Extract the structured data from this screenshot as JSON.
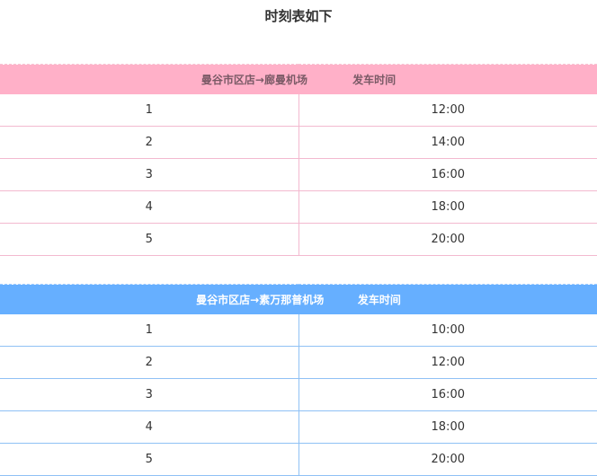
{
  "title": "时刻表如下",
  "tables": [
    {
      "header": "曼谷市区店→廊曼机场            发车时间",
      "accent": "#ffb0c8",
      "rows": [
        {
          "no": "1",
          "time": "12:00"
        },
        {
          "no": "2",
          "time": "14:00"
        },
        {
          "no": "3",
          "time": "16:00"
        },
        {
          "no": "4",
          "time": "18:00"
        },
        {
          "no": "5",
          "time": "20:00"
        }
      ]
    },
    {
      "header": "曼谷市区店→素万那普机场         发车时间",
      "accent": "#66afff",
      "rows": [
        {
          "no": "1",
          "time": "10:00"
        },
        {
          "no": "2",
          "time": "12:00"
        },
        {
          "no": "3",
          "time": "16:00"
        },
        {
          "no": "4",
          "time": "18:00"
        },
        {
          "no": "5",
          "time": "20:00"
        }
      ]
    }
  ]
}
